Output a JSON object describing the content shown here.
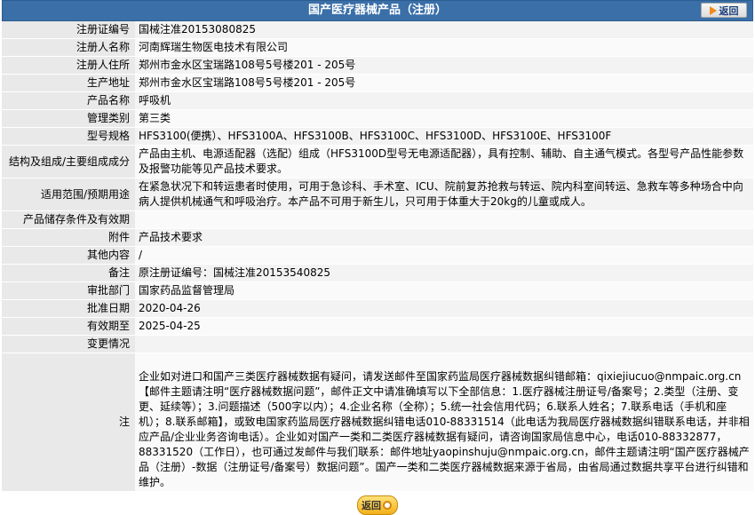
{
  "header": {
    "title": "国产医疗器械产品（注册）",
    "back_label": "返回"
  },
  "rows": [
    {
      "label": "注册证编号",
      "value": "国械注准20153080825"
    },
    {
      "label": "注册人名称",
      "value": "河南辉瑞生物医电技术有限公司"
    },
    {
      "label": "注册人住所",
      "value": "郑州市金水区宝瑞路108号5号楼201 - 205号"
    },
    {
      "label": "生产地址",
      "value": "郑州市金水区宝瑞路108号5号楼201 - 205号"
    },
    {
      "label": "产品名称",
      "value": "呼吸机"
    },
    {
      "label": "管理类别",
      "value": "第三类"
    },
    {
      "label": "型号规格",
      "value": "HFS3100(便携）、HFS3100A、HFS3100B、HFS3100C、HFS3100D、HFS3100E、HFS3100F"
    },
    {
      "label": "结构及组成/主要组成成分",
      "value": "产品由主机、电源适配器（选配）组成（HFS3100D型号无电源适配器），具有控制、辅助、自主通气模式。各型号产品性能参数及报警功能等见产品技术要求。"
    },
    {
      "label": "适用范围/预期用途",
      "value": "在紧急状况下和转运患者时使用，可用于急诊科、手术室、ICU、院前复苏抢救与转运、院内科室间转运、急救车等多种场合中向病人提供机械通气和呼吸治疗。本产品不可用于新生儿，只可用于体重大于20kg的儿童或成人。"
    },
    {
      "label": "产品储存条件及有效期",
      "value": ""
    },
    {
      "label": "附件",
      "value": "产品技术要求"
    },
    {
      "label": "其他内容",
      "value": "/"
    },
    {
      "label": "备注",
      "value": "原注册证编号：国械注准20153540825"
    },
    {
      "label": "审批部门",
      "value": "国家药品监督管理局"
    },
    {
      "label": "批准日期",
      "value": "2020-04-26"
    },
    {
      "label": "有效期至",
      "value": "2025-04-25"
    },
    {
      "label": "变更情况",
      "value": ""
    }
  ],
  "note": {
    "label": "注",
    "value": "企业如对进口和国产三类医疗器械数据有疑问，请发送邮件至国家药监局医疗器械数据纠错邮箱：qixiejiucuo@nmpaic.org.cn【邮件主题请注明“医疗器械数据问题”，邮件正文中请准确填写以下全部信息：1.医疗器械注册证号/备案号；2.类型（注册、变更、延续等）；3.问题描述（500字以内）；4.企业名称（全称）；5.统一社会信用代码；6.联系人姓名；7.联系电话（手机和座机）；8.联系邮箱】，或致电国家药监局医疗器械数据纠错电话010-88331514（此电话为我局医疗器械数据纠错联系电话，并非相应产品/企业业务咨询电话）。企业如对国产一类和二类医疗器械数据有疑问，请咨询国家局信息中心，电话010-88332877，88331520（工作日），也可通过发邮件与我们联系：邮件地址yaopinshuju@nmpaic.org.cn，邮件主题请注明“国产医疗器械产品（注册）-数据（注册证号/备案号）数据问题”。国产一类和二类医疗器械数据来源于省局，由省局通过数据共享平台进行纠错和维护。"
  },
  "footer": {
    "back_label": "返回"
  }
}
